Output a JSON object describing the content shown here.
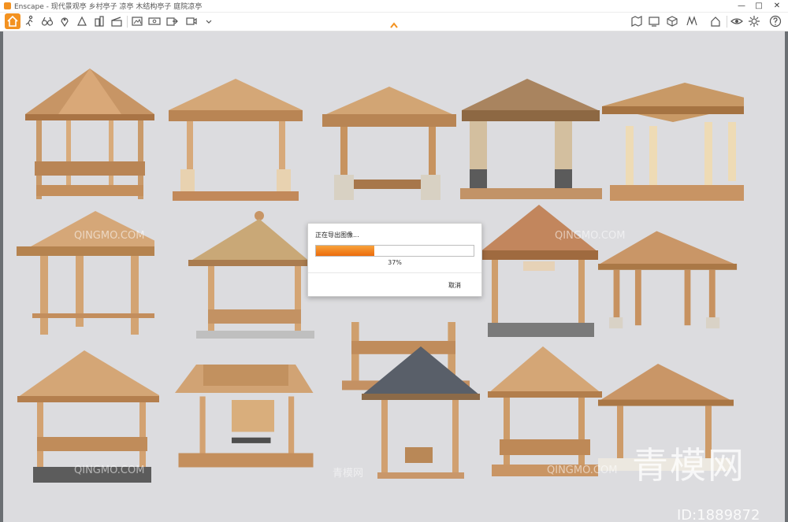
{
  "window": {
    "title": "Enscape - 现代景观亭 乡村亭子 凉亭 木结构亭子 庭院凉亭",
    "min": "—",
    "max": "□",
    "close": "✕"
  },
  "toolbar": {
    "left_icons": [
      "home-icon",
      "walk-icon",
      "binoculars-icon",
      "map-pin-icon",
      "upload-icon",
      "buildings-icon",
      "slate-icon",
      "screenshot-icon",
      "panorama-icon",
      "export-icon",
      "video-icon"
    ],
    "right_icons": [
      "map-icon",
      "screen-icon",
      "cube-icon",
      "vr-icon",
      "home-settings-icon",
      "eye-icon",
      "settings-icon",
      "help-icon"
    ],
    "accent_color": "#f39221"
  },
  "dialog": {
    "message": "正在导出图像...",
    "progress_percent": "37%",
    "progress_value": 0.37,
    "cancel_label": "取消"
  },
  "watermarks": {
    "brand": "QINGMO.COM",
    "cn": "青模网",
    "small_cn": "青模网",
    "id": "ID:1889872"
  }
}
